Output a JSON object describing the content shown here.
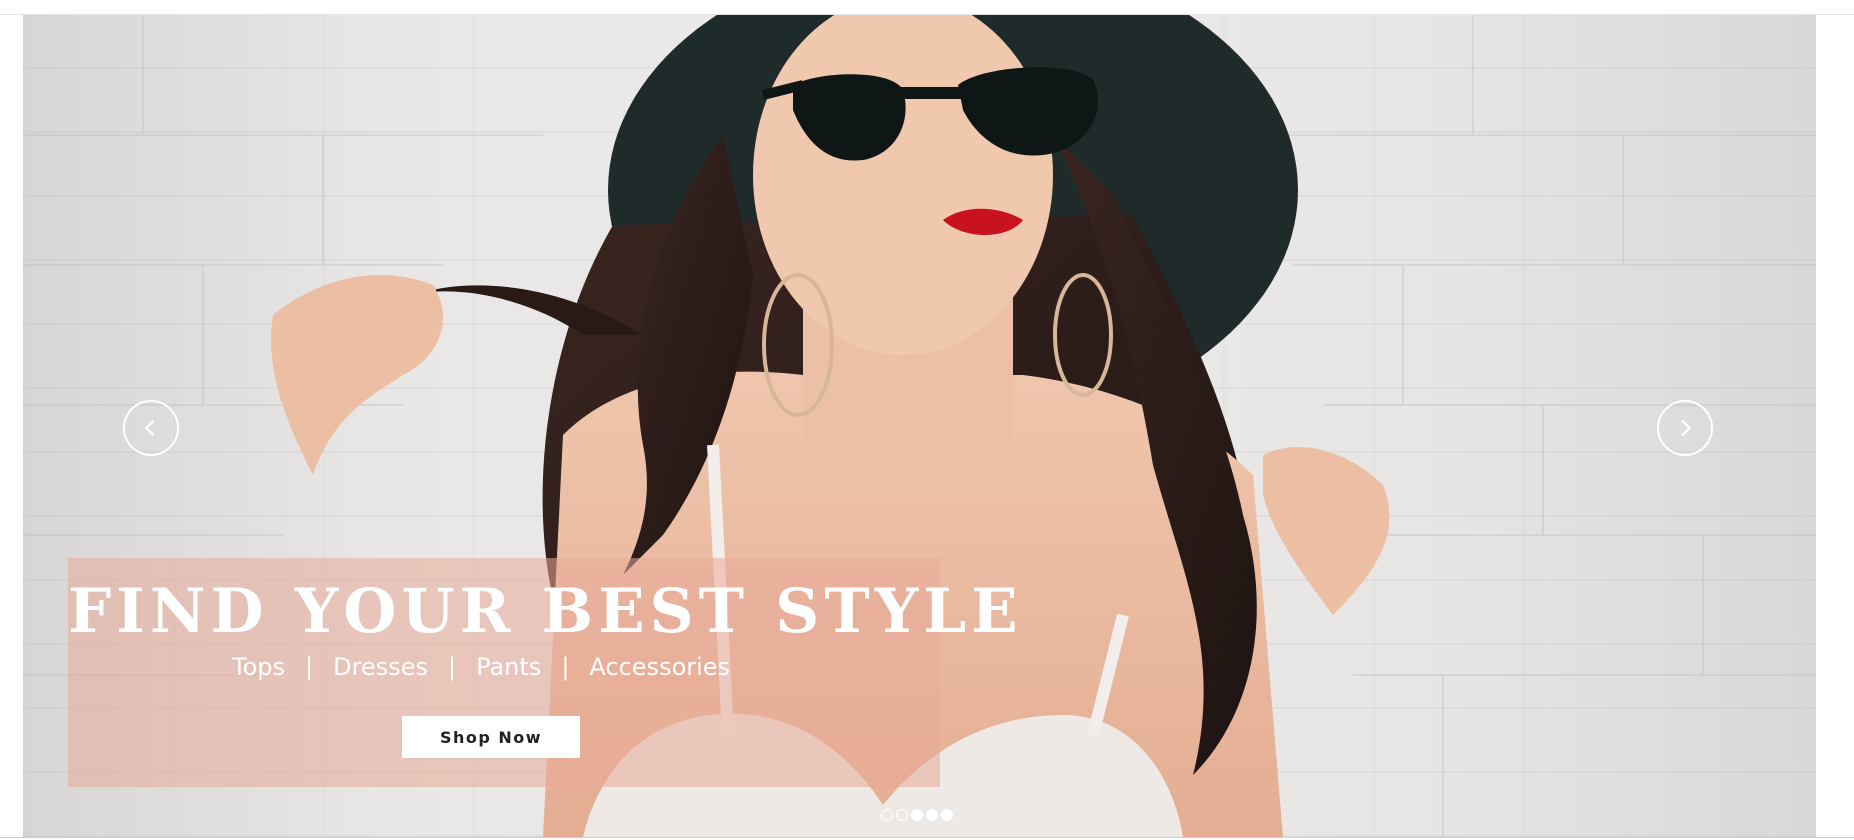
{
  "hero": {
    "headline": "FIND YOUR BEST STYLE",
    "categories": [
      "Tops",
      "Dresses",
      "Pants",
      "Accessories"
    ],
    "separator": "|",
    "cta_label": "Shop Now",
    "prev_icon": "chevron-left-icon",
    "next_icon": "chevron-right-icon",
    "slides": [
      {
        "filled": false
      },
      {
        "filled": false
      },
      {
        "filled": true
      },
      {
        "filled": true
      },
      {
        "filled": true
      }
    ]
  },
  "colors": {
    "overlay": "#e8aa98",
    "text": "#ffffff",
    "button_bg": "#ffffff",
    "button_text": "#222222"
  }
}
